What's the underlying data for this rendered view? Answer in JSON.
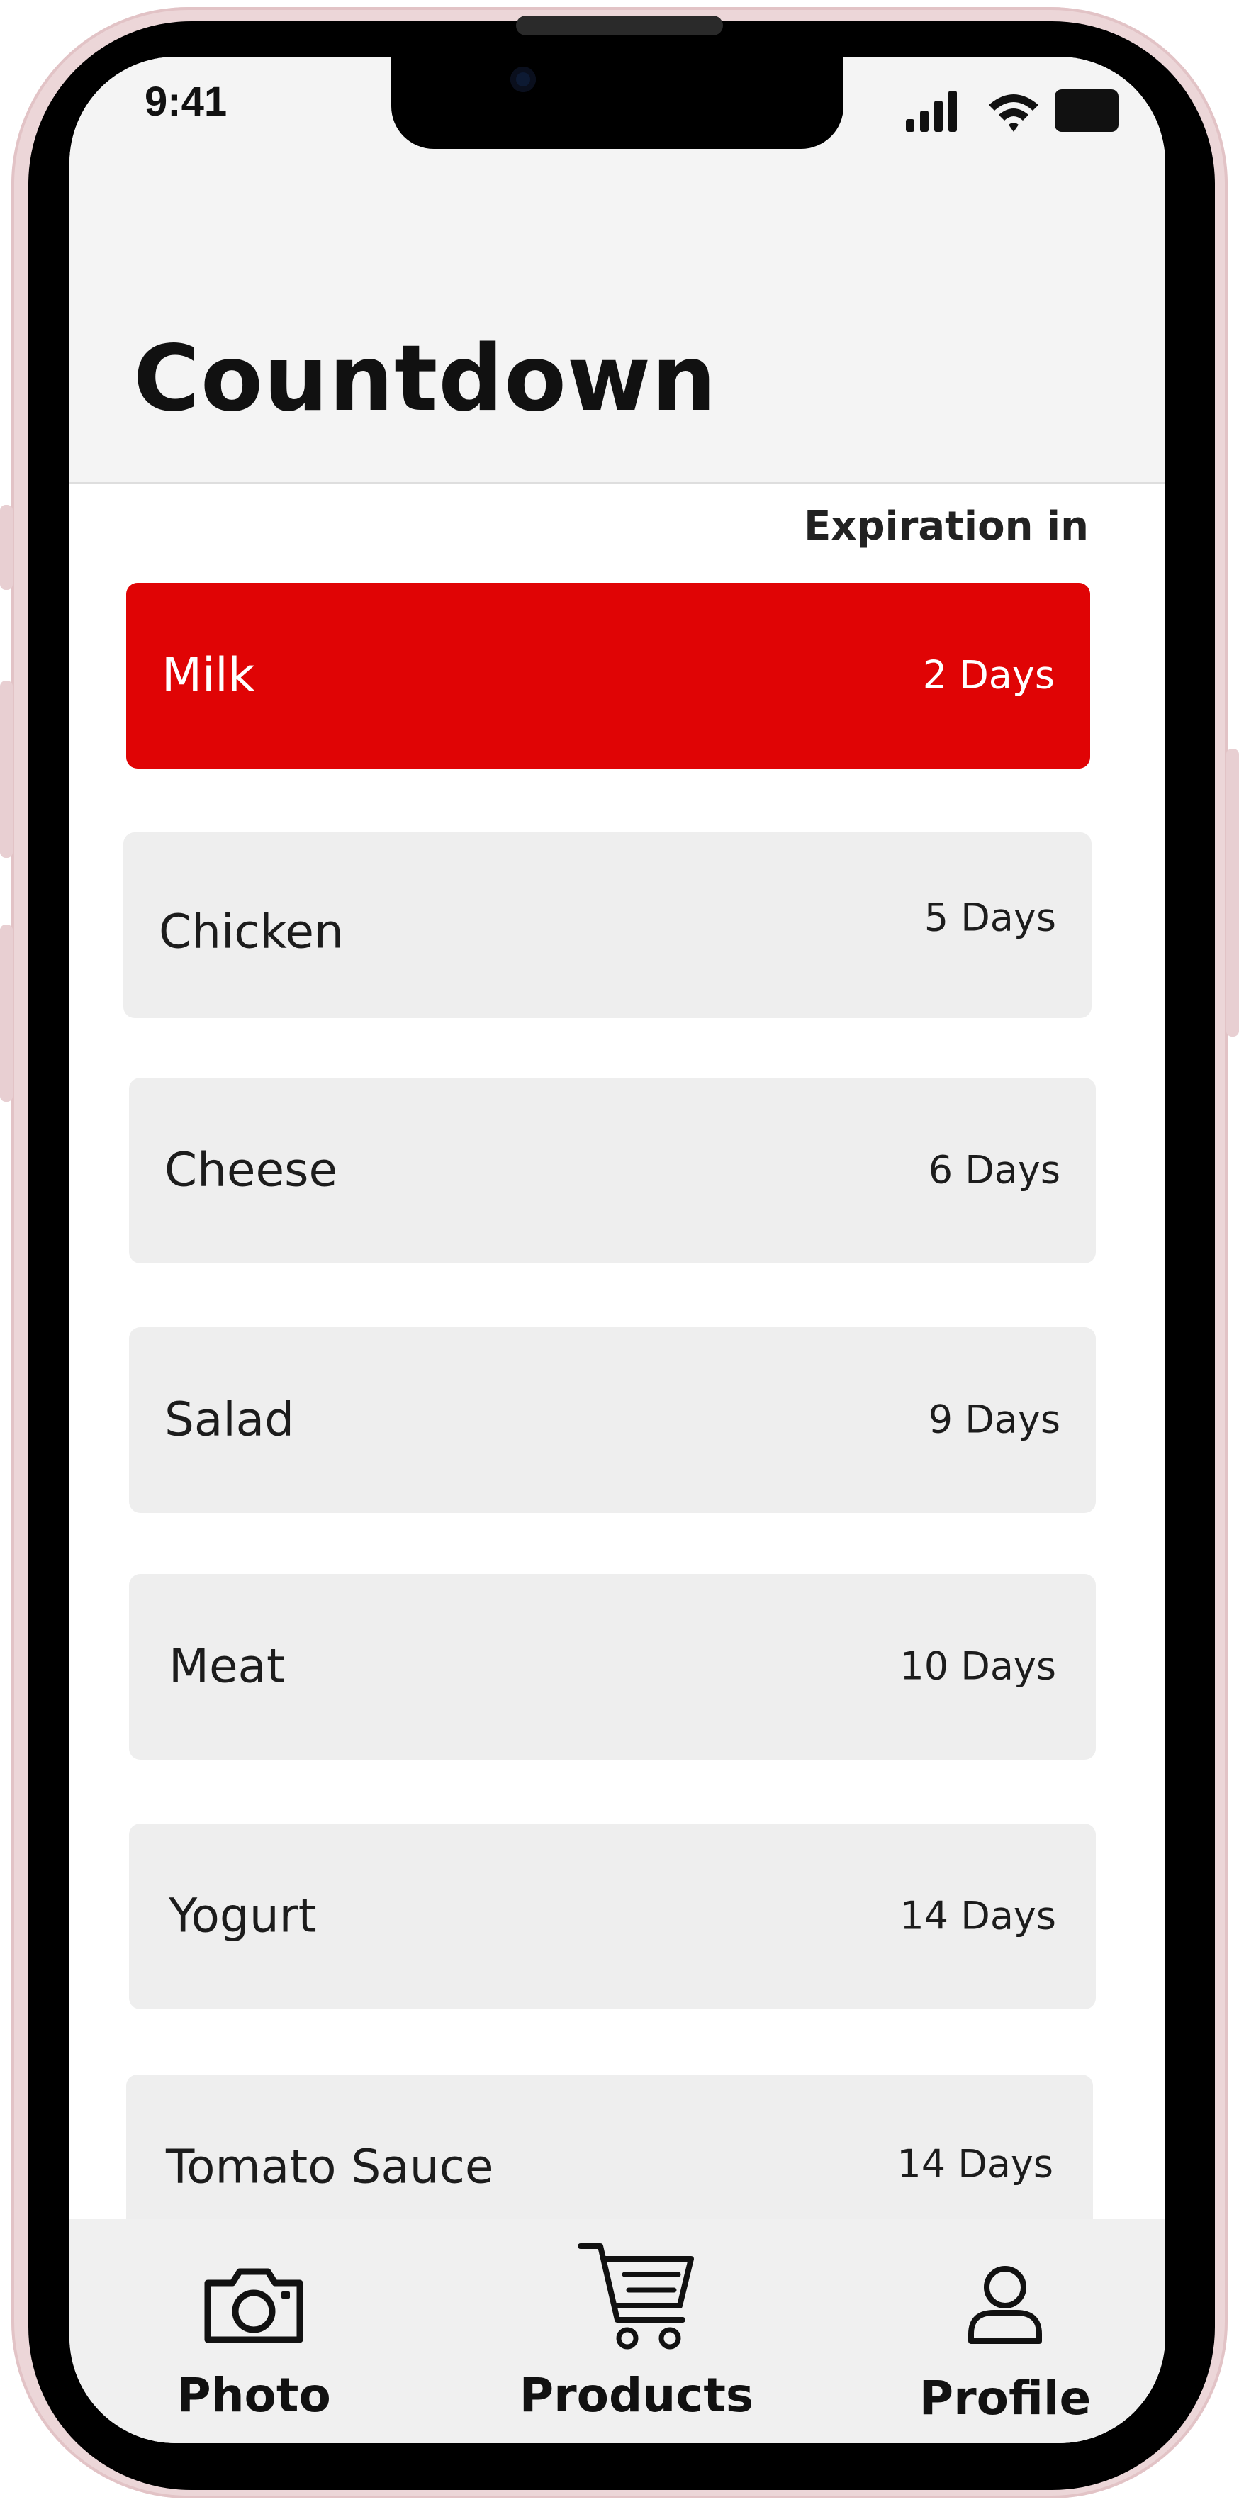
{
  "status_bar": {
    "time": "9:41",
    "signal_icon": "cellular-signal-icon",
    "wifi_icon": "wifi-icon",
    "battery_icon": "battery-icon"
  },
  "page": {
    "title": "Countdown",
    "column_label": "Expiration in"
  },
  "items": [
    {
      "name": "Milk",
      "days": "2 Days",
      "urgent": true
    },
    {
      "name": "Chicken",
      "days": "5 Days",
      "urgent": false
    },
    {
      "name": "Cheese",
      "days": "6 Days",
      "urgent": false
    },
    {
      "name": "Salad",
      "days": "9 Days",
      "urgent": false
    },
    {
      "name": "Meat",
      "days": "10 Days",
      "urgent": false
    },
    {
      "name": "Yogurt",
      "days": "14 Days",
      "urgent": false
    },
    {
      "name": "Tomato Sauce",
      "days": "14 Days",
      "urgent": false
    }
  ],
  "tabbar": {
    "photo": {
      "label": "Photo",
      "icon": "camera-icon"
    },
    "products": {
      "label": "Products",
      "icon": "shopping-cart-icon"
    },
    "profile": {
      "label": "Profile",
      "icon": "person-icon"
    }
  },
  "colors": {
    "urgent": "#e00405",
    "card": "#eeeeee",
    "header": "#f4f4f4",
    "tabbar": "#f0f0f0",
    "frame": "#ecd6d8"
  }
}
